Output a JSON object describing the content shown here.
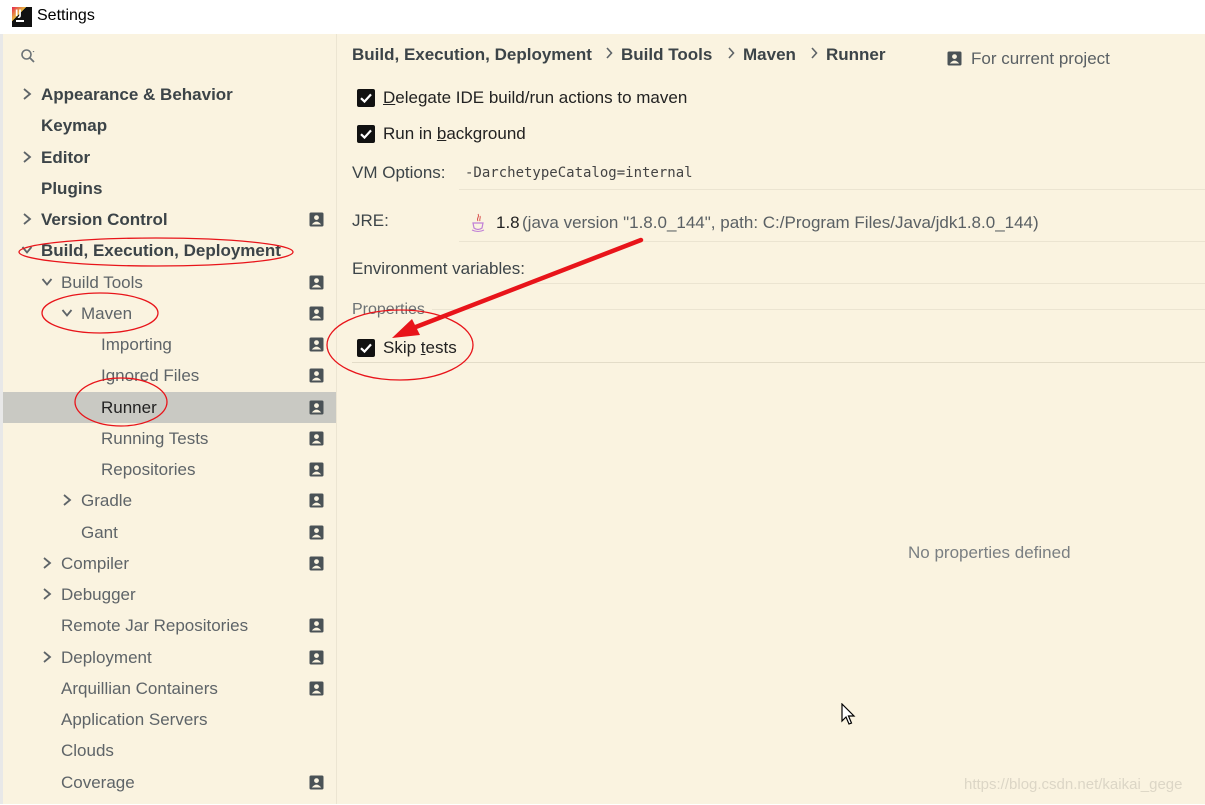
{
  "window": {
    "title": "Settings"
  },
  "sidebar": {
    "items": [
      {
        "label": "Appearance & Behavior",
        "bold": true,
        "arrow": "right",
        "project": false
      },
      {
        "label": "Keymap",
        "bold": true,
        "arrow": "",
        "project": false
      },
      {
        "label": "Editor",
        "bold": true,
        "arrow": "right",
        "project": false
      },
      {
        "label": "Plugins",
        "bold": true,
        "arrow": "",
        "project": false
      },
      {
        "label": "Version Control",
        "bold": true,
        "arrow": "right",
        "project": true
      },
      {
        "label": "Build, Execution, Deployment",
        "bold": true,
        "arrow": "down",
        "project": false
      },
      {
        "label": "Build Tools",
        "bold": false,
        "arrow": "down",
        "project": true
      },
      {
        "label": "Maven",
        "bold": false,
        "arrow": "down",
        "project": true
      },
      {
        "label": "Importing",
        "bold": false,
        "arrow": "",
        "project": true
      },
      {
        "label": "Ignored Files",
        "bold": false,
        "arrow": "",
        "project": true
      },
      {
        "label": "Runner",
        "bold": false,
        "arrow": "",
        "project": true,
        "selected": true
      },
      {
        "label": "Running Tests",
        "bold": false,
        "arrow": "",
        "project": true
      },
      {
        "label": "Repositories",
        "bold": false,
        "arrow": "",
        "project": true
      },
      {
        "label": "Gradle",
        "bold": false,
        "arrow": "right",
        "project": true
      },
      {
        "label": "Gant",
        "bold": false,
        "arrow": "",
        "project": true
      },
      {
        "label": "Compiler",
        "bold": false,
        "arrow": "right",
        "project": true
      },
      {
        "label": "Debugger",
        "bold": false,
        "arrow": "right",
        "project": false
      },
      {
        "label": "Remote Jar Repositories",
        "bold": false,
        "arrow": "",
        "project": true
      },
      {
        "label": "Deployment",
        "bold": false,
        "arrow": "right",
        "project": true
      },
      {
        "label": "Arquillian Containers",
        "bold": false,
        "arrow": "",
        "project": true
      },
      {
        "label": "Application Servers",
        "bold": false,
        "arrow": "",
        "project": false
      },
      {
        "label": "Clouds",
        "bold": false,
        "arrow": "",
        "project": false
      },
      {
        "label": "Coverage",
        "bold": false,
        "arrow": "",
        "project": true
      }
    ]
  },
  "breadcrumb": {
    "items": [
      "Build, Execution, Deployment",
      "Build Tools",
      "Maven",
      "Runner"
    ],
    "scope_label": "For current project"
  },
  "runner": {
    "delegate": {
      "pre": "",
      "u": "D",
      "post": "elegate IDE build/run actions to maven",
      "checked": true
    },
    "background": {
      "pre": "Run in ",
      "u": "b",
      "post": "ackground",
      "checked": true
    },
    "vm_options_label": "VM Options:",
    "vm_options_value": "-DarchetypeCatalog=internal",
    "jre_label": "JRE:",
    "jre_version": "1.8",
    "jre_detail": "(java version \"1.8.0_144\", path: C:/Program Files/Java/jdk1.8.0_144)",
    "env_label": "Environment variables:",
    "properties_label": "Properties",
    "skip_tests": {
      "pre": "Skip ",
      "u": "t",
      "post": "ests",
      "checked": true
    },
    "no_properties": "No properties defined"
  },
  "watermark": "https://blog.csdn.net/kaikai_gege",
  "colors": {
    "background": "#faf3e0",
    "selection": "#c9c9c3",
    "annotation": "#e8141a"
  }
}
